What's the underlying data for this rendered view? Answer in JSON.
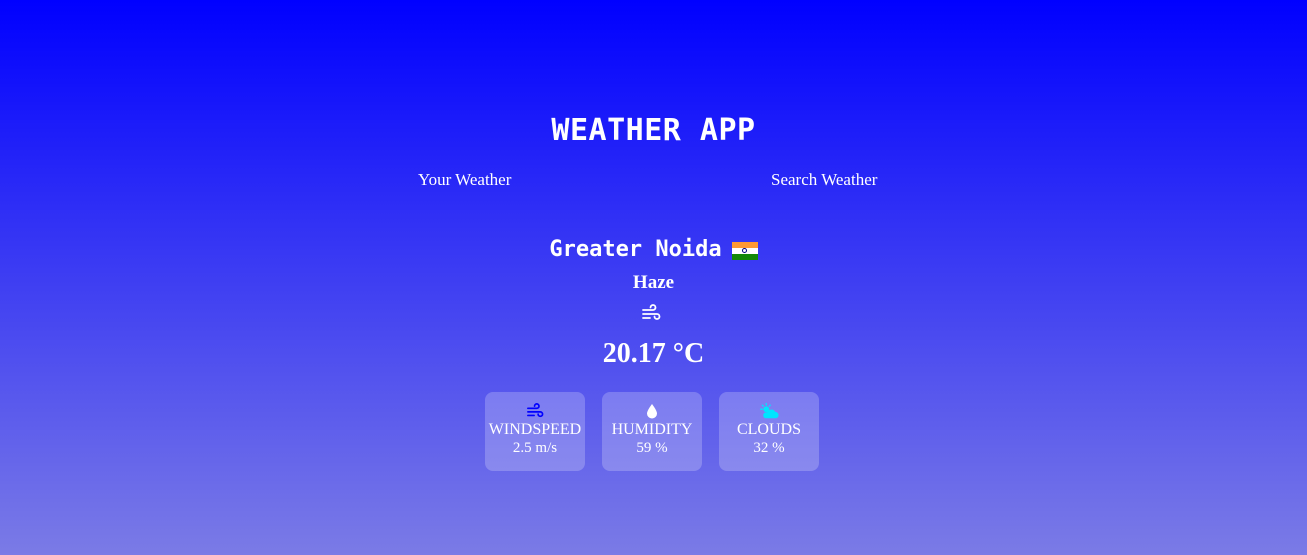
{
  "app": {
    "title": "WEATHER APP"
  },
  "nav": {
    "your_weather": "Your Weather",
    "search_weather": "Search Weather"
  },
  "location": {
    "city": "Greater Noida",
    "country_flag": "india-flag-icon"
  },
  "weather": {
    "description": "Haze",
    "description_icon": "haze-wind-icon",
    "temperature": "20.17 °C"
  },
  "stats": {
    "windspeed": {
      "label": "WINDSPEED",
      "value": "2.5 m/s",
      "icon": "wind-icon",
      "icon_color": "#0000ff"
    },
    "humidity": {
      "label": "HUMIDITY",
      "value": "59 %",
      "icon": "water-drop-icon",
      "icon_color": "#ffffff"
    },
    "clouds": {
      "label": "CLOUDS",
      "value": "32 %",
      "icon": "cloud-sun-icon",
      "icon_color": "#00e5ff"
    }
  },
  "colors": {
    "background_top": "#0000ff",
    "background_bottom": "#7b7be6",
    "card_background": "rgba(255,255,255,0.22)"
  }
}
